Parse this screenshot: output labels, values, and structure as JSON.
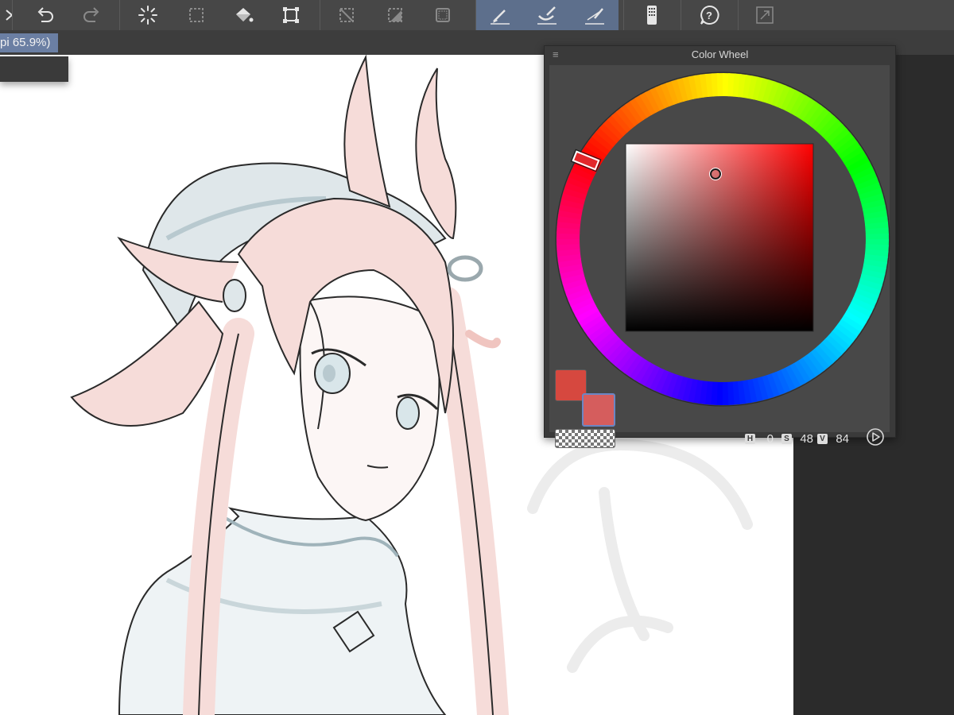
{
  "toolbar": {
    "tools": [
      {
        "name": "transform-icon",
        "state": "partial"
      },
      {
        "name": "undo-icon",
        "state": "enabled"
      },
      {
        "name": "redo-icon",
        "state": "disabled"
      },
      {
        "name": "loading-spinner-icon",
        "state": "enabled"
      },
      {
        "name": "selection-marquee-icon",
        "state": "disabled"
      },
      {
        "name": "paint-bucket-icon",
        "state": "enabled"
      },
      {
        "name": "transform-handles-icon",
        "state": "enabled"
      },
      {
        "name": "clear-selection-icon",
        "state": "disabled"
      },
      {
        "name": "invert-selection-icon",
        "state": "disabled"
      },
      {
        "name": "select-frame-icon",
        "state": "disabled"
      },
      {
        "name": "pen-ruler-icon",
        "state": "active"
      },
      {
        "name": "brush-ruler-icon",
        "state": "active"
      },
      {
        "name": "line-ruler-icon",
        "state": "active"
      },
      {
        "name": "device-panel-icon",
        "state": "enabled"
      },
      {
        "name": "help-icon",
        "state": "enabled"
      },
      {
        "name": "expand-icon",
        "state": "disabled"
      }
    ],
    "icon_color": "#e6e6e6",
    "disabled_color": "#8a8a8a",
    "active_bg": "#5d6f8c"
  },
  "document": {
    "tab_label": "pi 65.9%)"
  },
  "color_wheel": {
    "title": "Color Wheel",
    "menu_icon": "hamburger-icon",
    "hsv": {
      "h_label": "H",
      "h_value": "0",
      "s_label": "S",
      "s_value": "48",
      "v_label": "V",
      "v_value": "84"
    },
    "main_color": "#d6483f",
    "sub_color": "#d55d5d",
    "hue_marker_color": "#e3272b",
    "play_icon": "play-circle-icon"
  },
  "canvas": {
    "background": "#ffffff",
    "line_color": "#2a2a2a",
    "hair_color": "#f6dcd9",
    "cloth_color": "#dfe7ea"
  }
}
